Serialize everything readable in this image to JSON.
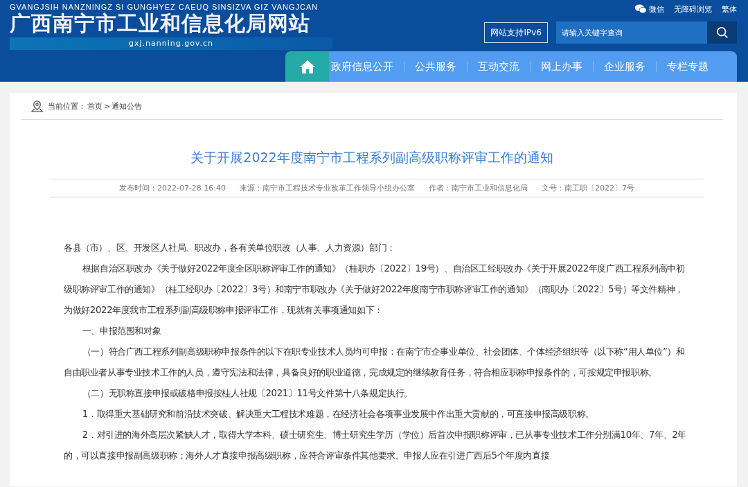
{
  "header": {
    "pinyin": "GVANGJSIH NANZNINGZ SI GUNGHYEZ CAEUQ SINSIZVA GIZ VANGJCAN",
    "site_title": "广西南宁市工业和信息化局网站",
    "domain": "gxj.nanning.gov.cn",
    "top_links": [
      {
        "kind": "wechat",
        "label": "微信"
      },
      {
        "kind": "plain",
        "label": "无障碍浏览"
      },
      {
        "kind": "plain",
        "label": "繁体"
      }
    ],
    "ipv6_badge": "网站支持IPv6",
    "search": {
      "placeholder": "请输入关键字查询"
    }
  },
  "nav": {
    "items": [
      {
        "label": "政府信息公开",
        "selected": false
      },
      {
        "label": "公共服务",
        "selected": false
      },
      {
        "label": "互动交流",
        "selected": false
      },
      {
        "label": "网上办事",
        "selected": false
      },
      {
        "label": "企业服务",
        "selected": false
      },
      {
        "label": "专栏专题",
        "selected": false
      }
    ]
  },
  "breadcrumb": {
    "prefix": "当前位置：",
    "items": [
      "首页",
      "通知公告"
    ],
    "separator": ">"
  },
  "article": {
    "title": "关于开展2022年度南宁市工程系列副高级职称评审工作的通知",
    "meta": [
      "发布时间：2022-07-28 16:40",
      "来源：南宁市工程技术专业改革工作领导小组办公室",
      "作者：南宁市工业和信息化局",
      "文号：南工职〔2022〕7号"
    ],
    "paragraphs": [
      {
        "kind": "salutation",
        "text": "各县（市）、区、开发区人社局、职改办，各有关单位职改（人事、人力资源）部门："
      },
      {
        "kind": "indent",
        "text": "根据自治区职改办《关于做好2022年度全区职称评审工作的通知》（桂职办〔2022〕19号）、自治区工经职改办《关于开展2022年度广西工程系列高中初级职称评审工作的通知》（桂工经职办〔2022〕3号）和南宁市职改办《关于做好2022年度南宁市职称评审工作的通知》（南职办〔2022〕5号）等文件精神，为做好2022年度我市工程系列副高级职称申报评审工作，现就有关事项通知如下："
      },
      {
        "kind": "indent",
        "text": "一、申报范围和对象"
      },
      {
        "kind": "indent",
        "text": "（一）符合广西工程系列副高级职称申报条件的以下在职专业技术人员均可申报：在南宁市企事业单位、社会团体、个体经济组织等（以下称“用人单位”）和自由职业者从事专业技术工作的人员，遵守宪法和法律，具备良好的职业道德，完成规定的继续教育任务，符合相应职称申报条件的，可按规定申报职称。"
      },
      {
        "kind": "indent",
        "text": "（二）无职称直接申报或破格申报按桂人社规〔2021〕11号文件第十八条规定执行。"
      },
      {
        "kind": "indent",
        "text": "1．取得重大基础研究和前沿技术突破、解决重大工程技术难题，在经济社会各项事业发展中作出重大贡献的，可直接申报高级职称。"
      },
      {
        "kind": "indent",
        "text": "2．对引进的海外高层次紧缺人才，取得大学本科、硕士研究生、博士研究生学历（学位）后首次申报职称评审，已从事专业技术工作分别满10年、7年、2年的，可以直接申报副高级职称；海外人才直接申报高级职称，应符合评审条件其他要求。申报人应在引进广西后5个年度内直接"
      }
    ]
  }
}
